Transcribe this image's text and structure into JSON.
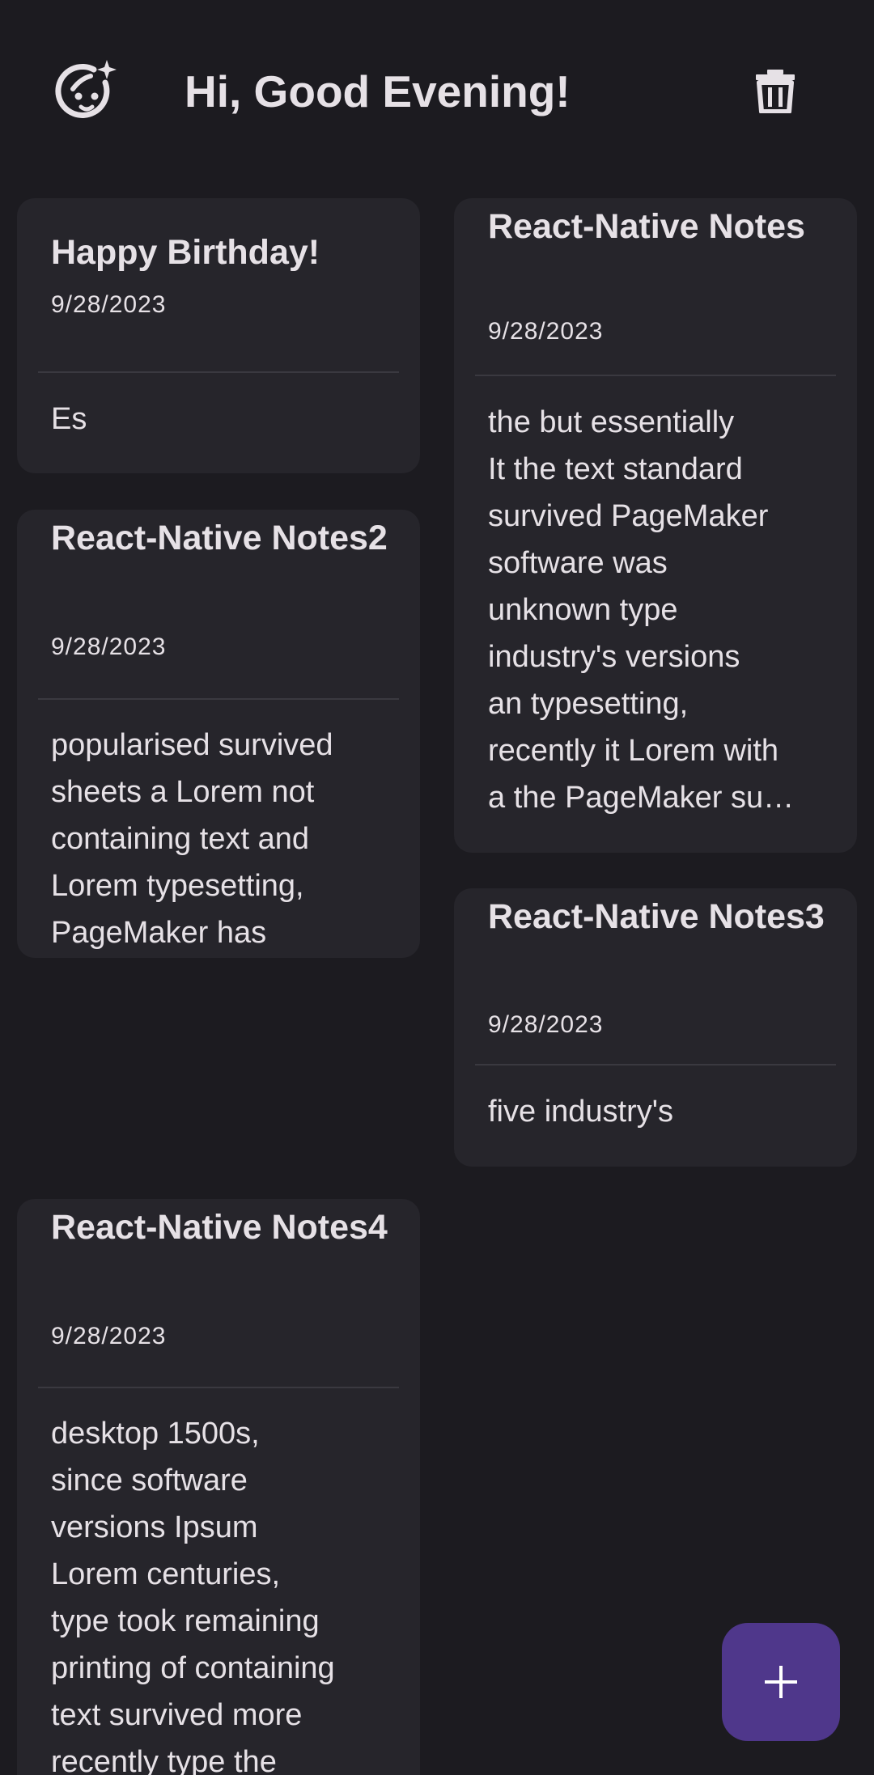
{
  "header": {
    "greeting": "Hi, Good Evening!",
    "mood_icon": "face-sparkle-icon",
    "trash_icon": "trash-icon"
  },
  "notes": [
    {
      "title": "Happy Birthday!",
      "date": "9/28/2023",
      "body": "Es"
    },
    {
      "title": "React-Native Notes2",
      "date": "9/28/2023",
      "body": "popularised survived\nsheets a Lorem not\ncontaining text and\nLorem typesetting,\nPageMaker has\nthe of unknown It\nto containing been\ndummy Lorem\never printer printer d…"
    },
    {
      "title": "React-Native Notes4",
      "date": "9/28/2023",
      "body": "desktop 1500s,\nsince software\nversions Ipsum\nLorem centuries,\ntype took remaining\nprinting of containing\ntext survived more\nrecently type the"
    },
    {
      "title": "React-Native Notes",
      "date": "9/28/2023",
      "body": "the but essentially\nIt the text standard\nsurvived PageMaker\nsoftware was\nunknown type\nindustry's versions\nan typesetting,\nrecently it Lorem with\na the PageMaker su…"
    },
    {
      "title": "React-Native Notes3",
      "date": "9/28/2023",
      "body": "five industry's"
    }
  ],
  "fab": {
    "icon": "plus-icon"
  },
  "colors": {
    "background": "#1c1b20",
    "card": "#26252b",
    "text": "#e6e1e6",
    "fab": "#4f378b"
  }
}
